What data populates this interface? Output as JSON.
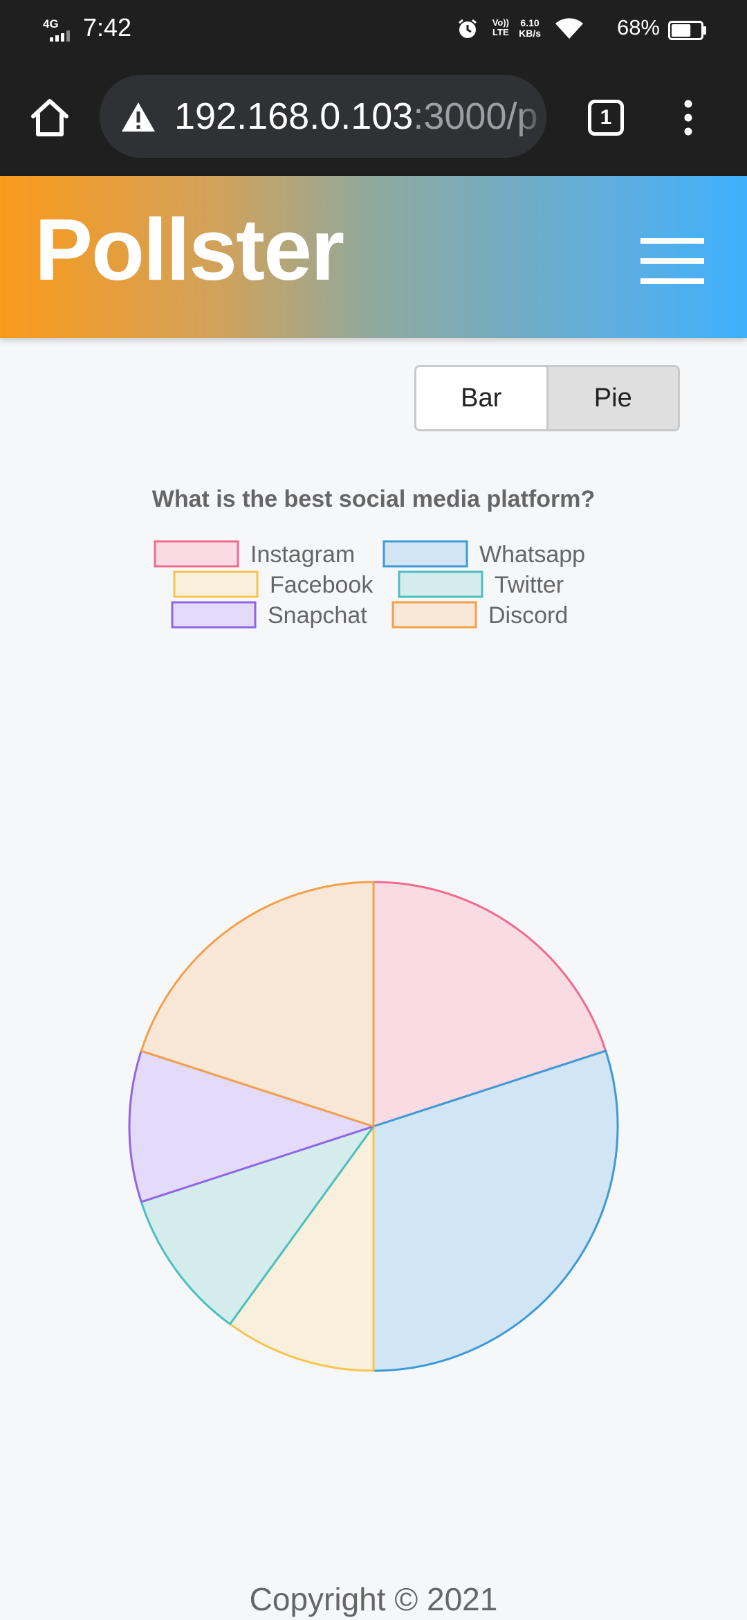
{
  "status_bar": {
    "network": "4G",
    "time": "7:42",
    "volte_line1": "Vo))",
    "volte_line2": "LTE",
    "speed_value": "6.10",
    "speed_unit": "KB/s",
    "battery": "68%",
    "battery_level": 0.68
  },
  "browser": {
    "url_host": "192.168.0.103",
    "url_rest": ":3000/p",
    "tab_count": "1"
  },
  "app": {
    "brand": "Pollster"
  },
  "chart_toggle": {
    "bar_label": "Bar",
    "pie_label": "Pie",
    "selected": "Pie"
  },
  "chart_data": {
    "type": "pie",
    "title": "What is the best social media platform?",
    "legend_position": "top",
    "categories": [
      "Instagram",
      "Whatsapp",
      "Facebook",
      "Twitter",
      "Snapchat",
      "Discord"
    ],
    "values": [
      2,
      3,
      1,
      1,
      1,
      2
    ],
    "fill_colors": [
      "#f9dbe3",
      "#d2e5f5",
      "#f8f0dc",
      "#d5ecec",
      "#e4daf9",
      "#f8e7d7"
    ],
    "border_colors": [
      "#f06b8e",
      "#3d9ad6",
      "#f6c54f",
      "#4bbfbf",
      "#9066e4",
      "#f3a04b"
    ]
  },
  "footer": {
    "copyright": "Copyright © 2021"
  }
}
